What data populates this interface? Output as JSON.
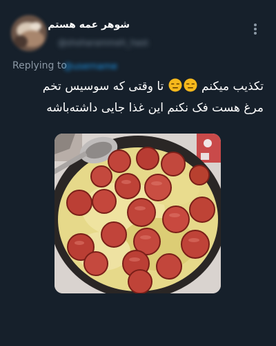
{
  "colors": {
    "background": "#16202b",
    "text_primary": "#ffffff",
    "text_secondary": "#8b98a5",
    "link": "#1d9bf0"
  },
  "tweet": {
    "author": {
      "display_name": "شوهر عمه هستم",
      "handle": "@shoharammeh_hastam"
    },
    "reply_context": {
      "label": "Replying to",
      "handle": "@username"
    },
    "text_line_1": "تکذیب میکنم",
    "text_line_1b": "تا وقتی که سوسیس تخم",
    "text_line_2": "مرغ هست فک نکنم این غذا جایی داشته‌باشه",
    "emoji": [
      "expressionless-face-icon",
      "expressionless-face-icon"
    ],
    "more_icon": "more-vertical-icon"
  }
}
